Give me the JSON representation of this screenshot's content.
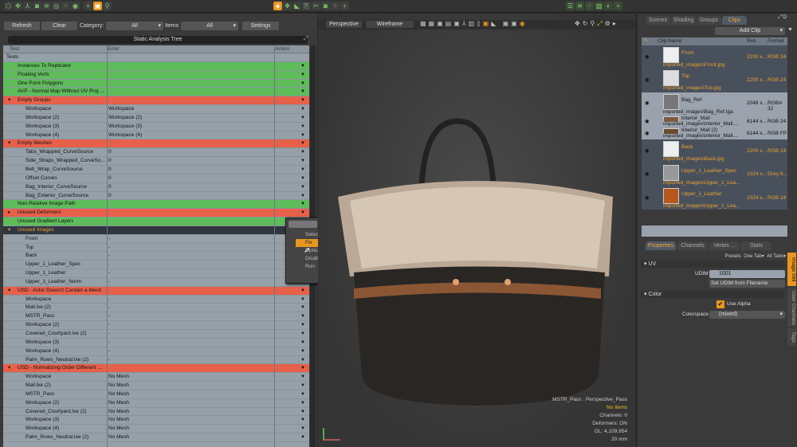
{
  "toolbar": {
    "left_icons": [
      "cube-icon",
      "move-icon",
      "skeleton-icon",
      "camera-icon",
      "layers-icon",
      "select-ring-icon",
      "dots-icon",
      "target-icon",
      "add-icon",
      "frame-icon",
      "search-icon"
    ],
    "right_icons": [
      "snap-icon",
      "move-icon",
      "scale-icon",
      "export-icon",
      "cut-icon",
      "camera-icon",
      "dots-icon",
      "add-icon",
      "list-icon",
      "layers-icon",
      "dots-icon",
      "image-icon",
      "toggle-icon",
      "add-icon"
    ]
  },
  "analysis": {
    "refresh": "Refresh",
    "clear": "Clear",
    "category_label": "Category:",
    "category_value": "All",
    "items_label": "Items",
    "items_value": "All",
    "settings": "Settings",
    "title": "Static Analysis Tree",
    "columns": {
      "test": "Test",
      "error": "Error",
      "action": "Action"
    },
    "rows": [
      {
        "t": "Tests",
        "e": "",
        "k": "root"
      },
      {
        "t": "Instances To Replicator",
        "e": "",
        "k": "g"
      },
      {
        "t": "Floating Verts",
        "e": "",
        "k": "g"
      },
      {
        "t": "One Point Polygons",
        "e": "",
        "k": "g"
      },
      {
        "t": "AVP - Normal Map Without UV Proj ...",
        "e": "",
        "k": "g"
      },
      {
        "t": "Empty Groups",
        "e": "",
        "k": "r"
      },
      {
        "t": "Workspace",
        "e": "Workspace",
        "k": "c"
      },
      {
        "t": "Workspace (2)",
        "e": "Workspace (2)",
        "k": "c"
      },
      {
        "t": "Workspace (3)",
        "e": "Workspace (3)",
        "k": "c"
      },
      {
        "t": "Workspace (4)",
        "e": "Workspace (4)",
        "k": "c"
      },
      {
        "t": "Empty Meshes",
        "e": "",
        "k": "r"
      },
      {
        "t": "Tabs_Wrapped_CurveSource",
        "e": "0",
        "k": "c"
      },
      {
        "t": "Side_Straps_Wrapped_CurveSo...",
        "e": "0",
        "k": "c"
      },
      {
        "t": "Belt_Wrap_CurveSource",
        "e": "0",
        "k": "c"
      },
      {
        "t": "Offset Curves",
        "e": "0",
        "k": "c"
      },
      {
        "t": "Bag_Interior_CurveSource",
        "e": "0",
        "k": "c"
      },
      {
        "t": "Bag_Exterior_CurveSource",
        "e": "0",
        "k": "c"
      },
      {
        "t": "Non-Relative Image Path",
        "e": "",
        "k": "g"
      },
      {
        "t": "Unused Deformers",
        "e": "",
        "k": "rc"
      },
      {
        "t": "Unused Gradient Layers",
        "e": "",
        "k": "g"
      },
      {
        "t": "Unused Images",
        "e": "",
        "k": "s"
      },
      {
        "t": "Front",
        "e": "-",
        "k": "c"
      },
      {
        "t": "Top",
        "e": "-",
        "k": "c"
      },
      {
        "t": "Back",
        "e": "-",
        "k": "c"
      },
      {
        "t": "Upper_1_Leather_Spec",
        "e": "-",
        "k": "c"
      },
      {
        "t": "Upper_1_Leather",
        "e": "-",
        "k": "c"
      },
      {
        "t": "Upper_1_Leather_Norm",
        "e": "-",
        "k": "c"
      },
      {
        "t": "USD - Actor Doesn't Contain a Mesh",
        "e": "",
        "k": "r"
      },
      {
        "t": "Workspace",
        "e": "-",
        "k": "c"
      },
      {
        "t": "Mall.lxe (2)",
        "e": "-",
        "k": "c"
      },
      {
        "t": "MSTR_Pass",
        "e": "-",
        "k": "c"
      },
      {
        "t": "Workspace (2)",
        "e": "-",
        "k": "c"
      },
      {
        "t": "Covered_Courtyard.lxe (2)",
        "e": "-",
        "k": "c"
      },
      {
        "t": "Workspace (3)",
        "e": "-",
        "k": "c"
      },
      {
        "t": "Workspace (4)",
        "e": "-",
        "k": "c"
      },
      {
        "t": "Palm_Rows_Neutral.lxe (2)",
        "e": "-",
        "k": "c"
      },
      {
        "t": "USD - Normalizing Order Different ...",
        "e": "",
        "k": "r"
      },
      {
        "t": "Workspace",
        "e": "No Mesh",
        "k": "c"
      },
      {
        "t": "Mall.lxe (2)",
        "e": "No Mesh",
        "k": "c"
      },
      {
        "t": "MSTR_Pass",
        "e": "No Mesh",
        "k": "c"
      },
      {
        "t": "Workspace (2)",
        "e": "No Mesh",
        "k": "c"
      },
      {
        "t": "Covered_Courtyard.lxe (2)",
        "e": "No Mesh",
        "k": "c"
      },
      {
        "t": "Workspace (3)",
        "e": "No Mesh",
        "k": "c"
      },
      {
        "t": "Workspace (4)",
        "e": "No Mesh",
        "k": "c"
      },
      {
        "t": "Palm_Rows_Neutral.lxe (2)",
        "e": "No Mesh",
        "k": "c"
      }
    ]
  },
  "context_menu": {
    "items": [
      "Select",
      "Fix",
      "Options",
      "Disable",
      "Run"
    ],
    "highlighted": "Fix"
  },
  "viewport": {
    "view": "Perspective",
    "shading": "Wireframe",
    "stats": {
      "pass": "MSTR_Pass : Perspective_Pass",
      "items": "No Items",
      "channels": "Channels: 0",
      "deformers": "Deformers: ON",
      "gl": "GL: 4,109,954",
      "scale": "20 mm"
    }
  },
  "clips_panel": {
    "tabs": [
      "Scenes",
      "Shading",
      "Groups",
      "Clips"
    ],
    "active_tab": "Clips",
    "add_clip": "Add Clip",
    "columns": {
      "name": "Clip Name",
      "res": "Res",
      "format": "Format"
    },
    "clips": [
      {
        "name": "Front",
        "path": "imported_images\\Front.jpg",
        "res": "2200 x...",
        "format": "RGB 24",
        "sel": true,
        "thumb": "#eee"
      },
      {
        "name": "Top",
        "path": "imported_images\\Top.jpg",
        "res": "2200 x...",
        "format": "RGB 24",
        "sel": true,
        "thumb": "#ddd"
      },
      {
        "name": "Bag_Ref",
        "path": "imported_images\\Bag_Ref.tga",
        "res": "2048 x...",
        "format": "RGBA 32",
        "sel": false,
        "thumb": "#777"
      },
      {
        "name": "Interior_Mall",
        "path": "imported_images\\Interior_Mall....",
        "res": "6144 x...",
        "format": "RGB 24",
        "sel": false,
        "thumb": "#7a5a40"
      },
      {
        "name": "Interior_Mall (2)",
        "path": "imported_images\\Interior_Mall....",
        "res": "6144 x...",
        "format": "RGB FP",
        "sel": false,
        "thumb": "#6a4a30"
      },
      {
        "name": "Back",
        "path": "imported_images\\Back.jpg",
        "res": "2200 x...",
        "format": "RGB 24",
        "sel": true,
        "thumb": "#eee"
      },
      {
        "name": "Upper_1_Leather_Spec",
        "path": "imported_images\\Upper_1_Lea...",
        "res": "1024 x...",
        "format": "Grey 8...",
        "sel": true,
        "thumb": "#999"
      },
      {
        "name": "Upper_1_Leather",
        "path": "imported_images\\Upper_1_Lea...",
        "res": "1024 x...",
        "format": "RGB 24",
        "sel": true,
        "thumb": "#b8571c"
      }
    ]
  },
  "properties": {
    "tabs": [
      "Properties",
      "Channels",
      "Vertex ...",
      "Stats"
    ],
    "active_tab": "Properties",
    "presets": "Presets",
    "one_tab": "One Tab",
    "all_tabs": "All Tabs",
    "uv_section": "UV",
    "udim_label": "UDIM",
    "udim_value": "1001",
    "set_udim": "Set UDIM from Filename",
    "color_section": "Color",
    "use_alpha": "Use Alpha",
    "use_alpha_checked": true,
    "colorspace_label": "Colorspace",
    "colorspace_value": "(mixed)",
    "side_tabs": [
      "Image Still",
      "User Channels",
      "Tags"
    ]
  },
  "colors": {
    "accent": "#e8961e",
    "pass": "#5fbc5a",
    "fail": "#e7604a"
  }
}
